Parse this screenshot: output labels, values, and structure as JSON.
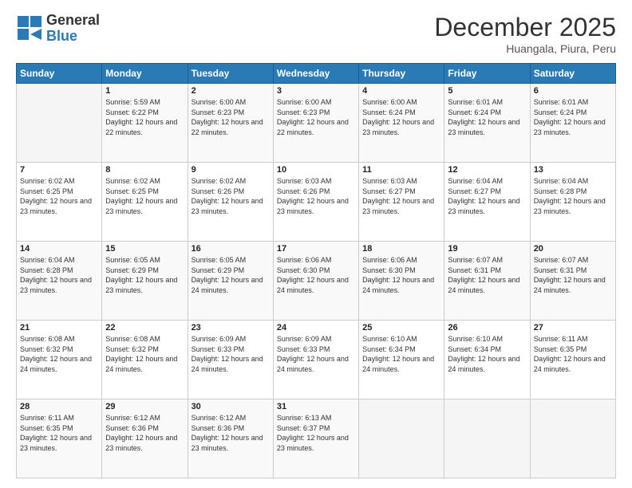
{
  "header": {
    "logo": {
      "line1": "General",
      "line2": "Blue",
      "icon": "▶"
    },
    "title": "December 2025",
    "subtitle": "Huangala, Piura, Peru"
  },
  "days_header": [
    "Sunday",
    "Monday",
    "Tuesday",
    "Wednesday",
    "Thursday",
    "Friday",
    "Saturday"
  ],
  "weeks": [
    [
      {
        "day": "",
        "sunrise": "",
        "sunset": "",
        "daylight": ""
      },
      {
        "day": "1",
        "sunrise": "Sunrise: 5:59 AM",
        "sunset": "Sunset: 6:22 PM",
        "daylight": "Daylight: 12 hours and 22 minutes."
      },
      {
        "day": "2",
        "sunrise": "Sunrise: 6:00 AM",
        "sunset": "Sunset: 6:23 PM",
        "daylight": "Daylight: 12 hours and 22 minutes."
      },
      {
        "day": "3",
        "sunrise": "Sunrise: 6:00 AM",
        "sunset": "Sunset: 6:23 PM",
        "daylight": "Daylight: 12 hours and 22 minutes."
      },
      {
        "day": "4",
        "sunrise": "Sunrise: 6:00 AM",
        "sunset": "Sunset: 6:24 PM",
        "daylight": "Daylight: 12 hours and 23 minutes."
      },
      {
        "day": "5",
        "sunrise": "Sunrise: 6:01 AM",
        "sunset": "Sunset: 6:24 PM",
        "daylight": "Daylight: 12 hours and 23 minutes."
      },
      {
        "day": "6",
        "sunrise": "Sunrise: 6:01 AM",
        "sunset": "Sunset: 6:24 PM",
        "daylight": "Daylight: 12 hours and 23 minutes."
      }
    ],
    [
      {
        "day": "7",
        "sunrise": "Sunrise: 6:02 AM",
        "sunset": "Sunset: 6:25 PM",
        "daylight": "Daylight: 12 hours and 23 minutes."
      },
      {
        "day": "8",
        "sunrise": "Sunrise: 6:02 AM",
        "sunset": "Sunset: 6:25 PM",
        "daylight": "Daylight: 12 hours and 23 minutes."
      },
      {
        "day": "9",
        "sunrise": "Sunrise: 6:02 AM",
        "sunset": "Sunset: 6:26 PM",
        "daylight": "Daylight: 12 hours and 23 minutes."
      },
      {
        "day": "10",
        "sunrise": "Sunrise: 6:03 AM",
        "sunset": "Sunset: 6:26 PM",
        "daylight": "Daylight: 12 hours and 23 minutes."
      },
      {
        "day": "11",
        "sunrise": "Sunrise: 6:03 AM",
        "sunset": "Sunset: 6:27 PM",
        "daylight": "Daylight: 12 hours and 23 minutes."
      },
      {
        "day": "12",
        "sunrise": "Sunrise: 6:04 AM",
        "sunset": "Sunset: 6:27 PM",
        "daylight": "Daylight: 12 hours and 23 minutes."
      },
      {
        "day": "13",
        "sunrise": "Sunrise: 6:04 AM",
        "sunset": "Sunset: 6:28 PM",
        "daylight": "Daylight: 12 hours and 23 minutes."
      }
    ],
    [
      {
        "day": "14",
        "sunrise": "Sunrise: 6:04 AM",
        "sunset": "Sunset: 6:28 PM",
        "daylight": "Daylight: 12 hours and 23 minutes."
      },
      {
        "day": "15",
        "sunrise": "Sunrise: 6:05 AM",
        "sunset": "Sunset: 6:29 PM",
        "daylight": "Daylight: 12 hours and 23 minutes."
      },
      {
        "day": "16",
        "sunrise": "Sunrise: 6:05 AM",
        "sunset": "Sunset: 6:29 PM",
        "daylight": "Daylight: 12 hours and 24 minutes."
      },
      {
        "day": "17",
        "sunrise": "Sunrise: 6:06 AM",
        "sunset": "Sunset: 6:30 PM",
        "daylight": "Daylight: 12 hours and 24 minutes."
      },
      {
        "day": "18",
        "sunrise": "Sunrise: 6:06 AM",
        "sunset": "Sunset: 6:30 PM",
        "daylight": "Daylight: 12 hours and 24 minutes."
      },
      {
        "day": "19",
        "sunrise": "Sunrise: 6:07 AM",
        "sunset": "Sunset: 6:31 PM",
        "daylight": "Daylight: 12 hours and 24 minutes."
      },
      {
        "day": "20",
        "sunrise": "Sunrise: 6:07 AM",
        "sunset": "Sunset: 6:31 PM",
        "daylight": "Daylight: 12 hours and 24 minutes."
      }
    ],
    [
      {
        "day": "21",
        "sunrise": "Sunrise: 6:08 AM",
        "sunset": "Sunset: 6:32 PM",
        "daylight": "Daylight: 12 hours and 24 minutes."
      },
      {
        "day": "22",
        "sunrise": "Sunrise: 6:08 AM",
        "sunset": "Sunset: 6:32 PM",
        "daylight": "Daylight: 12 hours and 24 minutes."
      },
      {
        "day": "23",
        "sunrise": "Sunrise: 6:09 AM",
        "sunset": "Sunset: 6:33 PM",
        "daylight": "Daylight: 12 hours and 24 minutes."
      },
      {
        "day": "24",
        "sunrise": "Sunrise: 6:09 AM",
        "sunset": "Sunset: 6:33 PM",
        "daylight": "Daylight: 12 hours and 24 minutes."
      },
      {
        "day": "25",
        "sunrise": "Sunrise: 6:10 AM",
        "sunset": "Sunset: 6:34 PM",
        "daylight": "Daylight: 12 hours and 24 minutes."
      },
      {
        "day": "26",
        "sunrise": "Sunrise: 6:10 AM",
        "sunset": "Sunset: 6:34 PM",
        "daylight": "Daylight: 12 hours and 24 minutes."
      },
      {
        "day": "27",
        "sunrise": "Sunrise: 6:11 AM",
        "sunset": "Sunset: 6:35 PM",
        "daylight": "Daylight: 12 hours and 24 minutes."
      }
    ],
    [
      {
        "day": "28",
        "sunrise": "Sunrise: 6:11 AM",
        "sunset": "Sunset: 6:35 PM",
        "daylight": "Daylight: 12 hours and 23 minutes."
      },
      {
        "day": "29",
        "sunrise": "Sunrise: 6:12 AM",
        "sunset": "Sunset: 6:36 PM",
        "daylight": "Daylight: 12 hours and 23 minutes."
      },
      {
        "day": "30",
        "sunrise": "Sunrise: 6:12 AM",
        "sunset": "Sunset: 6:36 PM",
        "daylight": "Daylight: 12 hours and 23 minutes."
      },
      {
        "day": "31",
        "sunrise": "Sunrise: 6:13 AM",
        "sunset": "Sunset: 6:37 PM",
        "daylight": "Daylight: 12 hours and 23 minutes."
      },
      {
        "day": "",
        "sunrise": "",
        "sunset": "",
        "daylight": ""
      },
      {
        "day": "",
        "sunrise": "",
        "sunset": "",
        "daylight": ""
      },
      {
        "day": "",
        "sunrise": "",
        "sunset": "",
        "daylight": ""
      }
    ]
  ]
}
